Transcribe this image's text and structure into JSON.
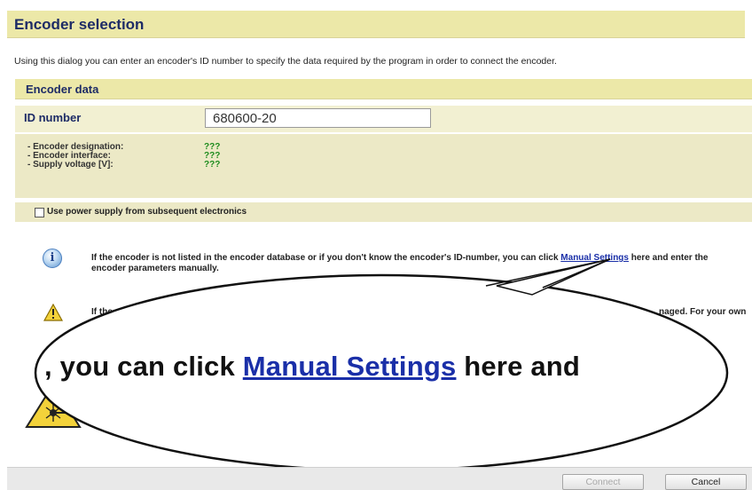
{
  "dialog": {
    "title": "Encoder selection",
    "intro": "Using this dialog you can enter an encoder's ID number to specify the data required by the program in order to connect the encoder."
  },
  "encoder_data": {
    "section_title": "Encoder data",
    "id_label": "ID number",
    "id_value": "680600-20",
    "details": [
      {
        "label": "- Encoder designation:",
        "value": "???"
      },
      {
        "label": "- Encoder interface:",
        "value": "???"
      },
      {
        "label": "- Supply voltage [V]:",
        "value": "???"
      }
    ],
    "checkbox_label": "Use power supply from subsequent electronics",
    "checkbox_checked": false
  },
  "info": {
    "text_before": "If the encoder is not listed in the encoder database or if you don't know the encoder's ID-number, you can click ",
    "link_text": "Manual Settings",
    "text_after": " here and enter the encoder parameters manually."
  },
  "warning": {
    "text_left": "If the sel",
    "text_right": "naged. For your own"
  },
  "callout": {
    "text_before": ", you can click ",
    "link_text": "Manual Settings",
    "text_after": " here and"
  },
  "footer": {
    "connect_label": "Connect",
    "cancel_label": "Cancel"
  },
  "colors": {
    "header_bg": "#ece8a8",
    "title_text": "#1d2b66",
    "value_green": "#1e8c1e",
    "link_blue": "#1a2fa8"
  },
  "icons": [
    "info-icon",
    "warning-icon",
    "laser-warning-icon"
  ]
}
